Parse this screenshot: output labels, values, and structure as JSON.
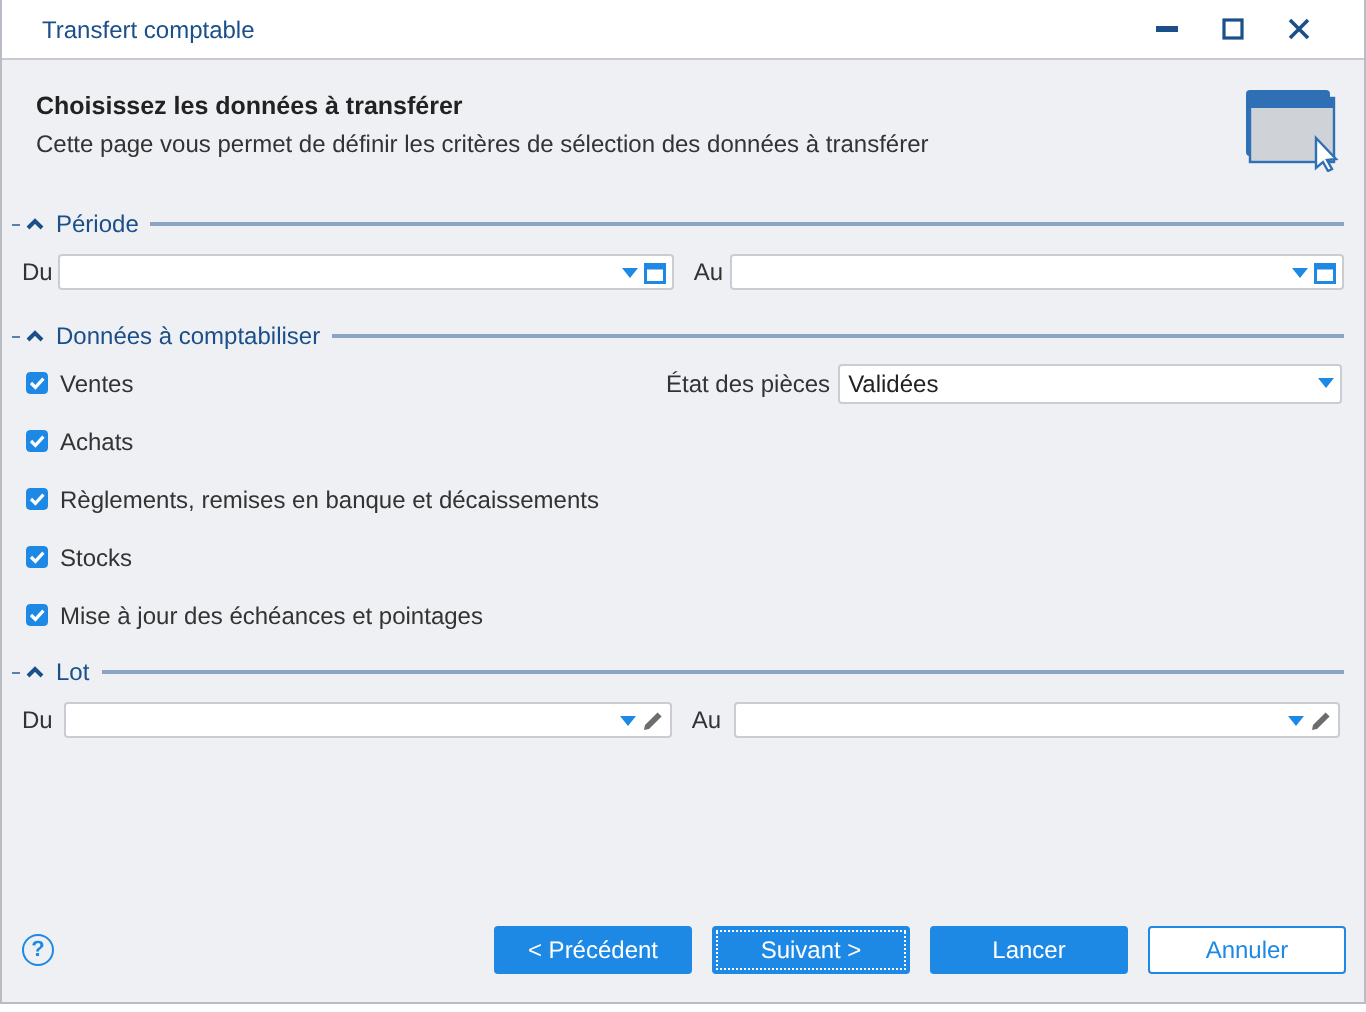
{
  "window": {
    "title": "Transfert comptable"
  },
  "header": {
    "title": "Choisissez les données à transférer",
    "subtitle": "Cette page vous permet de définir les critères de sélection des données à transférer"
  },
  "sections": [
    {
      "kind": "range",
      "title": "Période",
      "expanded": true,
      "fields": [
        {
          "label": "Du",
          "kind": "date"
        },
        {
          "label": "Au",
          "kind": "date"
        }
      ]
    },
    {
      "kind": "checks",
      "title": "Données à comptabiliser",
      "expanded": true,
      "combo": {
        "label": "État des pièces",
        "value": "Validées"
      },
      "items": [
        {
          "label": "Ventes",
          "checked": true
        },
        {
          "label": "Achats",
          "checked": true
        },
        {
          "label": "Règlements, remises en banque et décaissements",
          "checked": true
        },
        {
          "label": "Stocks",
          "checked": true
        },
        {
          "label": "Mise à jour des échéances et pointages",
          "checked": true
        }
      ]
    },
    {
      "kind": "range",
      "title": "Lot",
      "expanded": true,
      "fields": [
        {
          "label": "Du",
          "kind": "lot"
        },
        {
          "label": "Au",
          "kind": "lot"
        }
      ]
    }
  ],
  "footer": {
    "help": "?",
    "buttons": [
      {
        "label": "< Précédent",
        "kind": "primary",
        "focused": false
      },
      {
        "label": "Suivant >",
        "kind": "primary",
        "focused": true
      },
      {
        "label": "Lancer",
        "kind": "primary",
        "focused": false
      },
      {
        "label": "Annuler",
        "kind": "secondary",
        "focused": false
      }
    ]
  }
}
